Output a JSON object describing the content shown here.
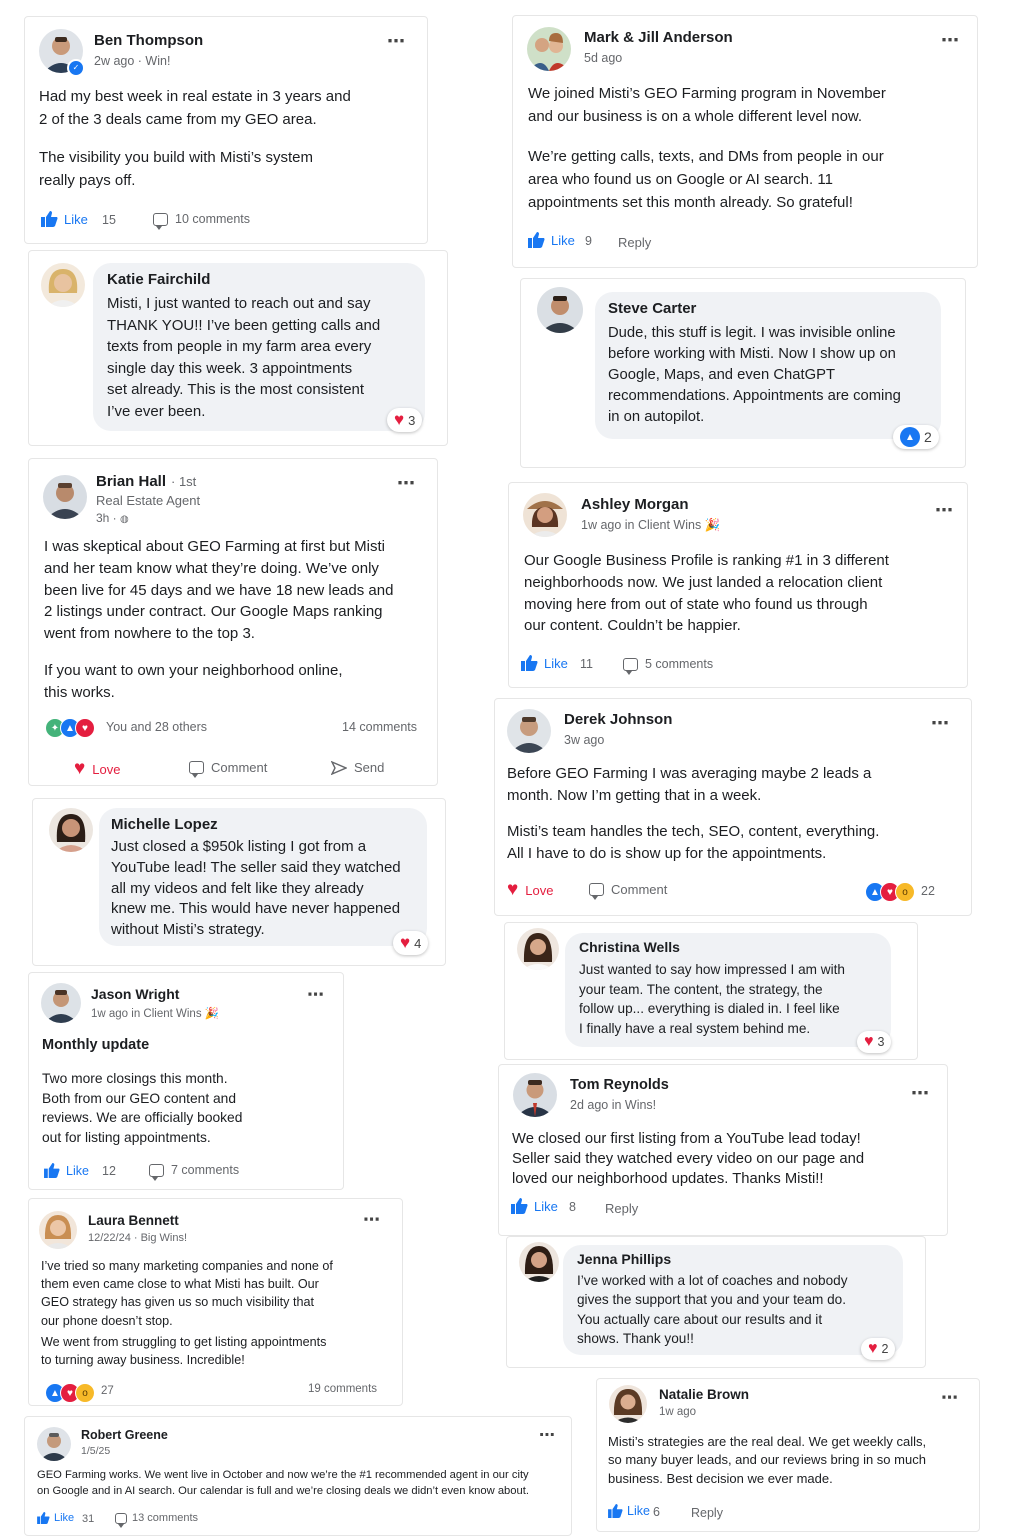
{
  "colors": {
    "brand_blue": "#1877f2",
    "love_red": "#e41e3f",
    "text_gray": "#65676b",
    "bubble_bg": "#f0f2f5"
  },
  "posts": {
    "ben": {
      "name": "Ben Thompson",
      "meta": "2w ago  ·  Win!",
      "p1": "Had my best week in real estate in 3 years and\n2 of the 3 deals came from my GEO area.",
      "p2": "The visibility you build with Misti’s system\nreally pays off.",
      "like_label": "Like",
      "likes": "15",
      "comments": "10 comments"
    },
    "katie": {
      "name": "Katie Fairchild",
      "text": "Misti, I just wanted to reach out and say\nTHANK YOU!! I’ve been getting calls and\ntexts from people in my farm area every\nsingle day this week. 3 appointments\nset already. This is the most consistent\nI’ve ever been.",
      "react": "3"
    },
    "brian": {
      "name": "Brian Hall",
      "degree": "· 1st",
      "title": "Real Estate Agent",
      "meta": "3h ·",
      "p1": "I was skeptical about GEO Farming at first but Misti\nand her team know what they’re doing. We’ve only\nbeen live for 45 days and we have 18 new leads and\n2 listings under contract. Our Google Maps ranking\nwent from nowhere to the top 3.",
      "p2": "If you want to own your neighborhood online,\nthis works.",
      "reactions": "You and 28 others",
      "comments": "14 comments",
      "love": "Love",
      "comment": "Comment",
      "send": "Send"
    },
    "michelle": {
      "name": "Michelle Lopez",
      "text": "Just closed a $950k listing I got from a\nYouTube lead! The seller said they watched\nall my videos and felt like they already\nknew me. This would have never happened\nwithout Misti’s strategy.",
      "react": "4"
    },
    "jason": {
      "name": "Jason Wright",
      "meta": "1w ago in Client Wins 🎉",
      "heading": "Monthly update",
      "text": "Two more closings this month.\nBoth from our GEO content and\nreviews. We are officially booked\nout for listing appointments.",
      "like_label": "Like",
      "likes": "12",
      "comments": "7 comments"
    },
    "laura": {
      "name": "Laura Bennett",
      "meta": "12/22/24  ·  Big Wins!",
      "p1": "I’ve tried so many marketing companies and none of\nthem even came close to what Misti has built. Our\nGEO strategy has given us so much visibility that\nour phone doesn’t stop.",
      "p2": "We went from struggling to get listing appointments\nto turning away business. Incredible!",
      "reactions": "27",
      "comments": "19 comments"
    },
    "robert": {
      "name": "Robert Greene",
      "meta": "1/5/25",
      "text": "GEO Farming works. We went live in October and now we’re the #1 recommended agent in our city\non Google and in AI search. Our calendar is full and we’re closing deals we didn’t even know about.",
      "like_label": "Like",
      "likes": "31",
      "comments": "13 comments"
    },
    "mark": {
      "name": "Mark & Jill Anderson",
      "meta": "5d ago",
      "p1": "We joined Misti’s GEO Farming program in November\nand our business is on a whole different level now.",
      "p2": "We’re getting calls, texts, and DMs from people in our\narea who found us on Google or AI search.  11\nappointments set this month already. So grateful!",
      "like_label": "Like",
      "likes": "9",
      "reply": "Reply"
    },
    "steve": {
      "name": "Steve Carter",
      "text": "Dude, this stuff is legit. I was invisible online\nbefore working with Misti. Now I show up on\nGoogle, Maps, and even ChatGPT\nrecommendations. Appointments are coming\nin on autopilot.",
      "react": "2"
    },
    "ashley": {
      "name": "Ashley Morgan",
      "meta": "1w ago in Client Wins 🎉",
      "text": "Our Google Business Profile is ranking #1 in 3 different\nneighborhoods now. We just landed a relocation client\nmoving here from out of state who found us through\nour content. Couldn’t be happier.",
      "like_label": "Like",
      "likes": "11",
      "comments": "5 comments"
    },
    "derek": {
      "name": "Derek Johnson",
      "meta": "3w ago",
      "p1": "Before GEO Farming I was averaging maybe 2 leads a\nmonth. Now I’m getting that in a week.",
      "p2": "Misti’s team handles the tech, SEO, content, everything.\nAll I have to do is show up for the appointments.",
      "love": "Love",
      "comment": "Comment",
      "reactions": "22"
    },
    "christina": {
      "name": "Christina Wells",
      "text": "Just wanted to say how impressed I am with\nyour team. The content, the strategy, the\nfollow up... everything is dialed in. I feel like\nI finally have a real system behind me.",
      "react": "3"
    },
    "tom": {
      "name": "Tom Reynolds",
      "meta": "2d ago in Wins!",
      "text": "We closed our first listing from a YouTube lead today!\nSeller said they watched every video on our page and\nloved our neighborhood updates. Thanks Misti!!",
      "like_label": "Like",
      "likes": "8",
      "reply": "Reply"
    },
    "jenna": {
      "name": "Jenna Phillips",
      "text": "I’ve worked with a lot of coaches and nobody\ngives the support that you and your team do.\nYou actually care about our results and it\nshows. Thank you!!",
      "react": "2"
    },
    "natalie": {
      "name": "Natalie Brown",
      "meta": "1w ago",
      "text": "Misti’s strategies are the real deal. We get weekly calls,\nso many buyer leads, and our reviews bring in so much\nbusiness. Best decision we ever made.",
      "like_label": "Like",
      "likes": "6",
      "reply": "Reply"
    }
  },
  "icons": {
    "more": "⋯",
    "heart": "♥",
    "globe": "🌐"
  }
}
